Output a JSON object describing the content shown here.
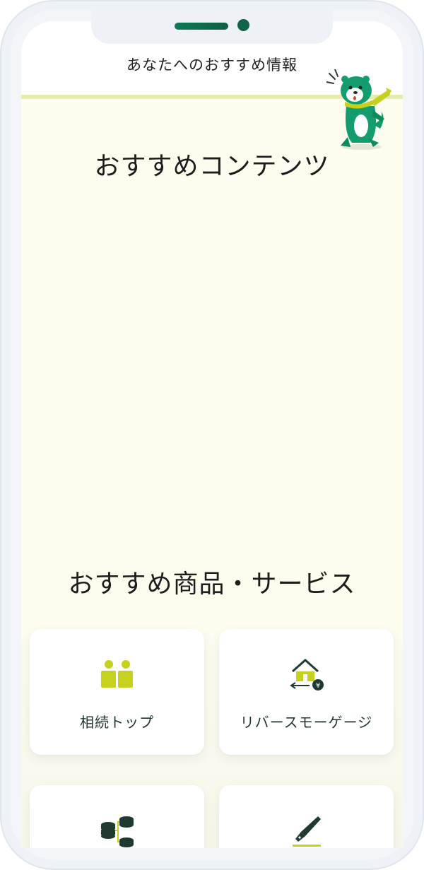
{
  "header": {
    "title": "あなたへのおすすめ情報"
  },
  "sections": {
    "contents_title": "おすすめコンテンツ",
    "products_title": "おすすめ商品・サービス"
  },
  "products": [
    {
      "label": "相続トップ",
      "icon": "two-people-icon"
    },
    {
      "label": "リバースモーゲージ",
      "icon": "house-yen-icon"
    },
    {
      "label": "",
      "icon": "coin-stacks-icon"
    },
    {
      "label": "",
      "icon": "pen-nib-icon"
    }
  ],
  "colors": {
    "accent_lime": "#c5d11d",
    "accent_green": "#0d7a55",
    "background_cream": "#fdfcef",
    "rule_lime": "#e6ecaa"
  },
  "mascot": {
    "icon": "green-mascot-icon"
  }
}
